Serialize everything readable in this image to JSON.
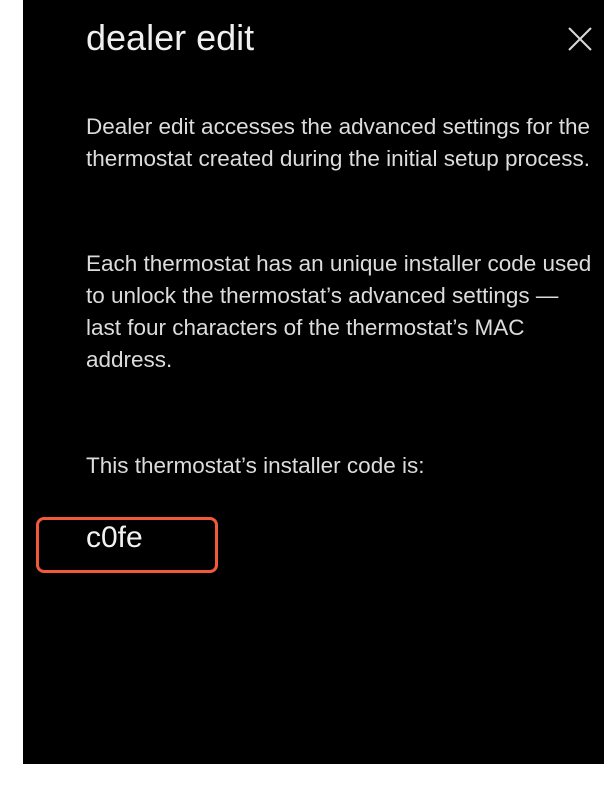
{
  "title": "dealer edit",
  "close_icon": "close-icon",
  "paragraphs": {
    "intro": "Dealer edit accesses the advanced settings for the thermostat created during the initial setup process.",
    "installer_code_info": "Each thermostat has an unique installer code used to unlock the thermostat’s advanced settings — last four characters of the thermostat’s MAC address.",
    "code_label": "This thermostat’s installer code is:"
  },
  "installer_code": "c0fe",
  "colors": {
    "background": "#000000",
    "text": "#e9e9e9",
    "highlight_border": "#f05a3a"
  }
}
